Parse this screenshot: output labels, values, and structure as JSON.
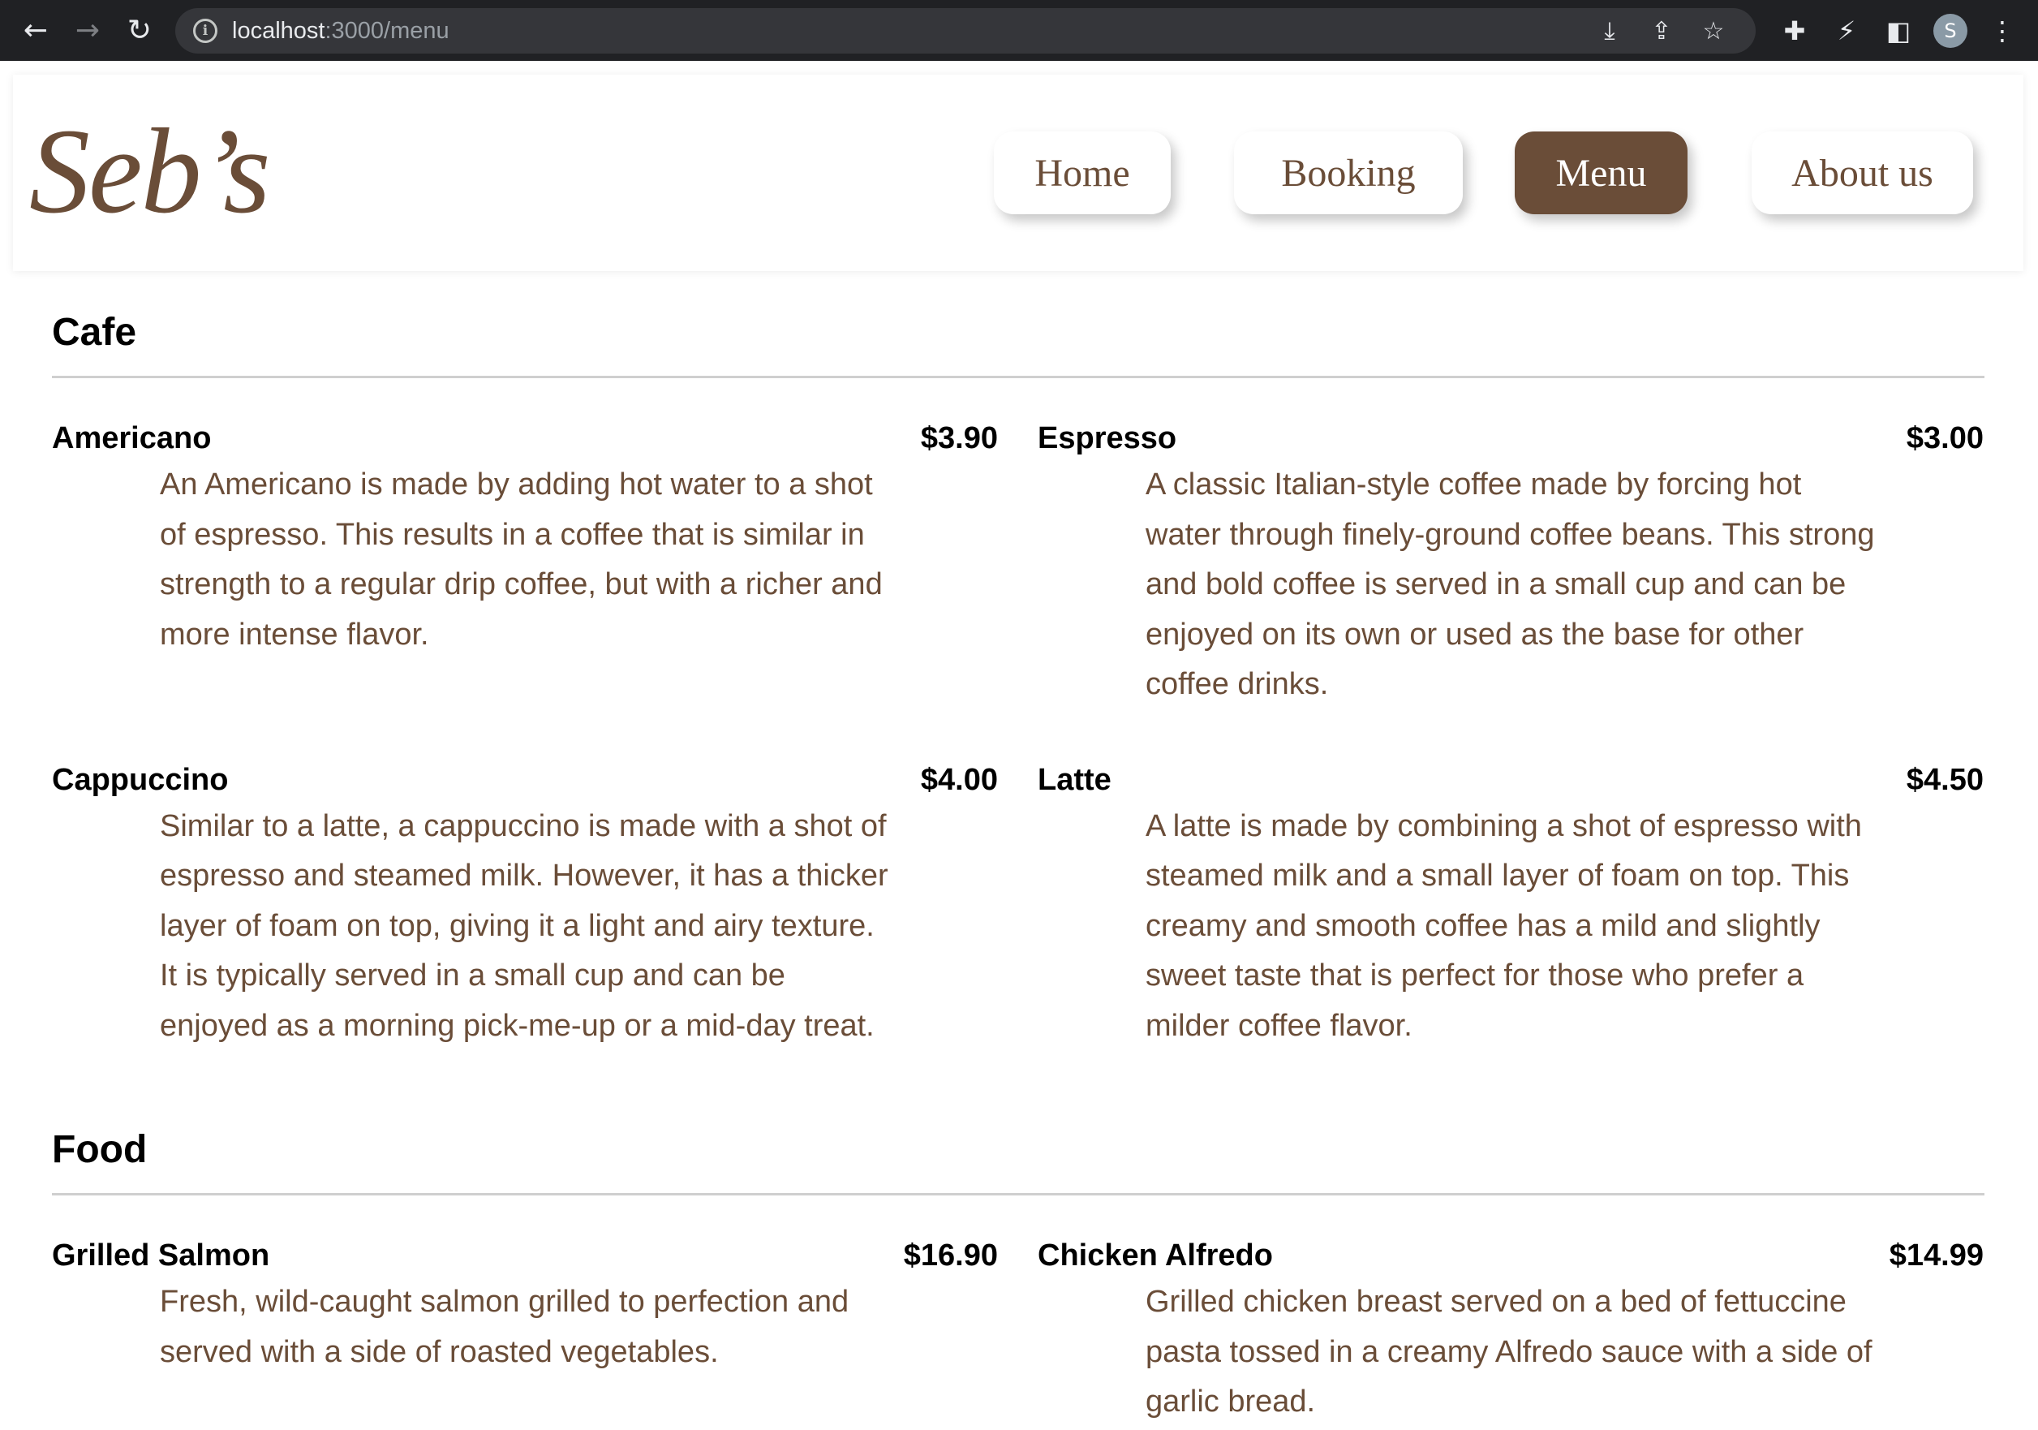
{
  "browser": {
    "url_host": "localhost",
    "url_path": ":3000/menu",
    "profile_initial": "S"
  },
  "header": {
    "logo": "Seb’s",
    "nav": [
      {
        "label": "Home",
        "active": false
      },
      {
        "label": "Booking",
        "active": false
      },
      {
        "label": "Menu",
        "active": true
      },
      {
        "label": "About us",
        "active": false
      }
    ]
  },
  "colors": {
    "brand_brown": "#6a4d38",
    "chrome_bg": "#202124",
    "divider": "#cfcfcf"
  },
  "sections": [
    {
      "title": "Cafe",
      "items": [
        {
          "name": "Americano",
          "price": "$3.90",
          "description": "An Americano is made by adding hot water to a shot of espresso. This results in a coffee that is similar in strength to a regular drip coffee, but with a richer and more intense flavor."
        },
        {
          "name": "Espresso",
          "price": "$3.00",
          "description": "A classic Italian-style coffee made by forcing hot water through finely-ground coffee beans. This strong and bold coffee is served in a small cup and can be enjoyed on its own or used as the base for other coffee drinks."
        },
        {
          "name": "Cappuccino",
          "price": "$4.00",
          "description": "Similar to a latte, a cappuccino is made with a shot of espresso and steamed milk. However, it has a thicker layer of foam on top, giving it a light and airy texture. It is typically served in a small cup and can be enjoyed as a morning pick-me-up or a mid-day treat."
        },
        {
          "name": "Latte",
          "price": "$4.50",
          "description": "A latte is made by combining a shot of espresso with steamed milk and a small layer of foam on top. This creamy and smooth coffee has a mild and slightly sweet taste that is perfect for those who prefer a milder coffee flavor."
        }
      ]
    },
    {
      "title": "Food",
      "items": [
        {
          "name": "Grilled Salmon",
          "price": "$16.90",
          "description": "Fresh, wild-caught salmon grilled to perfection and served with a side of roasted vegetables."
        },
        {
          "name": "Chicken Alfredo",
          "price": "$14.99",
          "description": "Grilled chicken breast served on a bed of fettuccine pasta tossed in a creamy Alfredo sauce with a side of garlic bread."
        }
      ]
    }
  ]
}
